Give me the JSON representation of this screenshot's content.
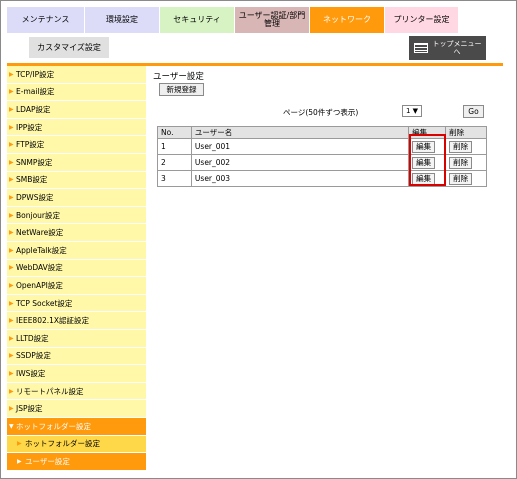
{
  "tabs": {
    "maintenance": "メンテナンス",
    "environment": "環境設定",
    "security": "セキュリティ",
    "user_auth_line1": "ユーザー認証/部門",
    "user_auth_line2": "管理",
    "network": "ネットワーク",
    "printer": "プリンター設定"
  },
  "subbar": {
    "customize": "カスタマイズ設定",
    "top_menu_line1": "トップメニュー",
    "top_menu_line2": "へ"
  },
  "sidebar": {
    "items": [
      {
        "label": "TCP/IP設定"
      },
      {
        "label": "E-mail設定"
      },
      {
        "label": "LDAP設定"
      },
      {
        "label": "IPP設定"
      },
      {
        "label": "FTP設定"
      },
      {
        "label": "SNMP設定"
      },
      {
        "label": "SMB設定"
      },
      {
        "label": "DPWS設定"
      },
      {
        "label": "Bonjour設定"
      },
      {
        "label": "NetWare設定"
      },
      {
        "label": "AppleTalk設定"
      },
      {
        "label": "WebDAV設定"
      },
      {
        "label": "OpenAPI設定"
      },
      {
        "label": "TCP Socket設定"
      },
      {
        "label": "IEEE802.1X認証設定"
      },
      {
        "label": "LLTD設定"
      },
      {
        "label": "SSDP設定"
      },
      {
        "label": "IWS設定"
      },
      {
        "label": "リモートパネル設定"
      },
      {
        "label": "JSP設定"
      },
      {
        "label": "ホットフォルダー設定"
      },
      {
        "label": "ホットフォルダー設定"
      },
      {
        "label": "ユーザー設定"
      }
    ]
  },
  "main": {
    "title": "ユーザー設定",
    "new_button": "新規登録",
    "page_label": "ページ(50件ずつ表示)",
    "page_value": "1",
    "go_button": "Go",
    "table": {
      "headers": [
        "No.",
        "ユーザー名",
        "編集",
        "削除"
      ],
      "rows": [
        {
          "no": "1",
          "name": "User_001",
          "edit": "編集",
          "delete": "削除"
        },
        {
          "no": "2",
          "name": "User_002",
          "edit": "編集",
          "delete": "削除"
        },
        {
          "no": "3",
          "name": "User_003",
          "edit": "編集",
          "delete": "削除"
        }
      ]
    }
  },
  "colors": {
    "accent_orange": "#ff9a0d",
    "sidebar_yellow": "#fff8a8",
    "highlight_red": "#d90000"
  }
}
